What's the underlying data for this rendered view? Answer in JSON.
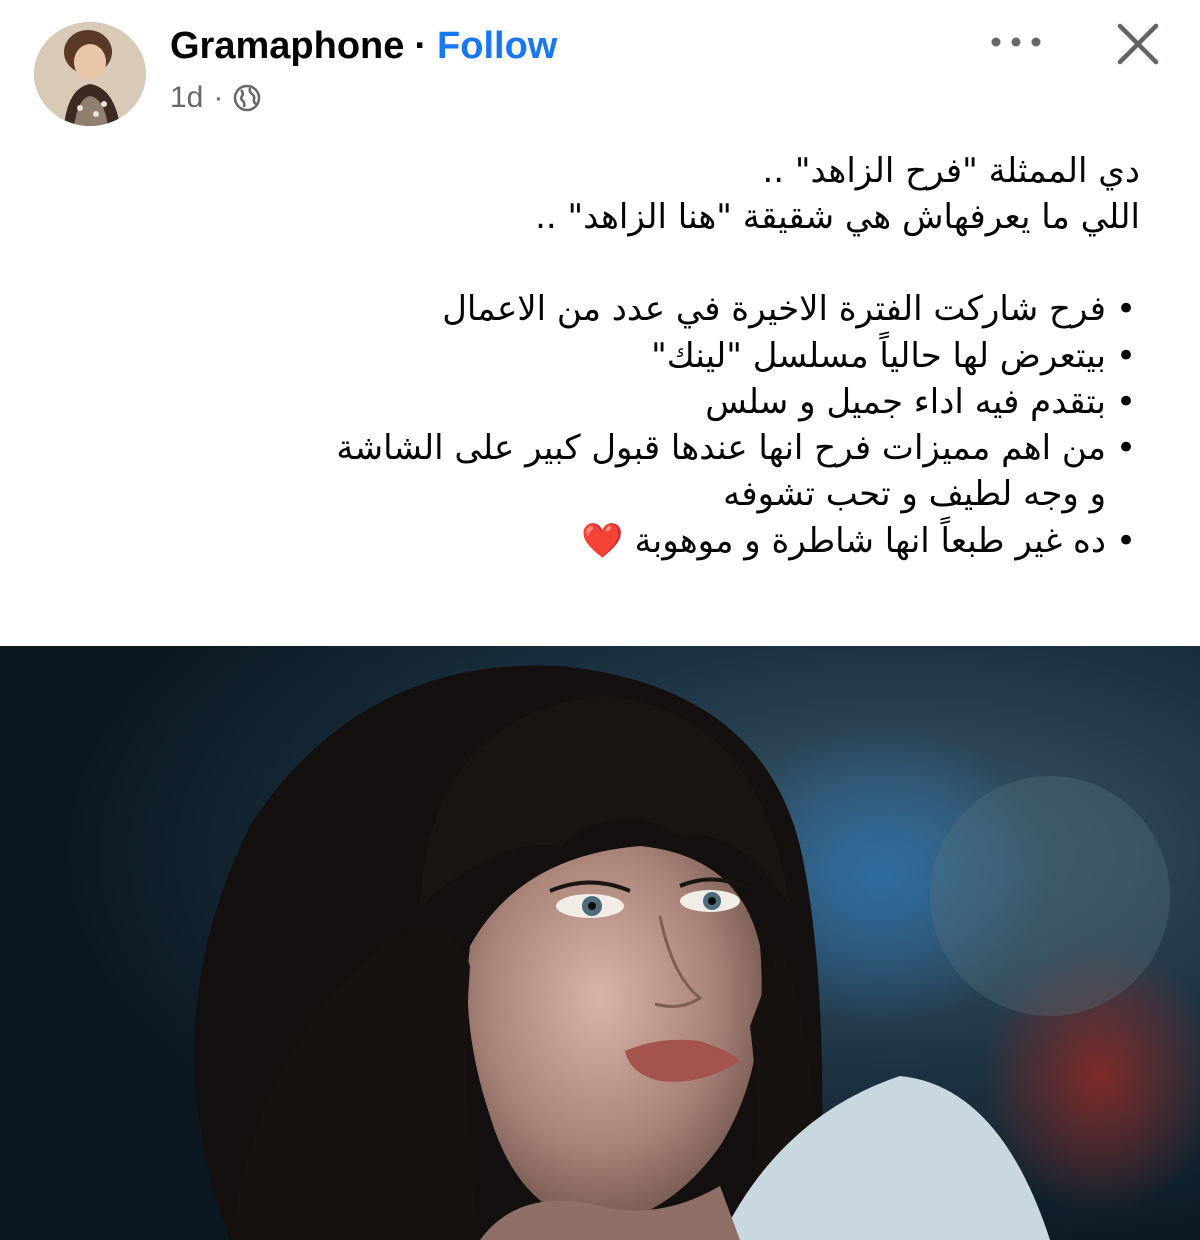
{
  "header": {
    "author_name": "Gramaphone",
    "separator": "·",
    "follow_label": "Follow",
    "timestamp": "1d",
    "meta_separator": "·",
    "privacy_icon": "globe-icon",
    "more_icon": "more-options-icon",
    "close_icon": "close-icon"
  },
  "post": {
    "intro_lines": [
      "دي الممثلة \"فرح الزاهد\"  ..",
      "اللي ما يعرفهاش هي شقيقة \"هنا الزاهد\"  .."
    ],
    "bullets": [
      "فرح شاركت الفترة الاخيرة في عدد من الاعمال",
      "بيتعرض لها حالياً مسلسل \"لينك\"",
      "بتقدم فيه اداء جميل و سلس",
      "من اهم مميزات فرح انها عندها قبول كبير على الشاشة\nو وجه لطيف و تحب تشوفه",
      "ده غير طبعاً انها شاطرة و موهوبة ❤️"
    ]
  },
  "colors": {
    "follow": "#1877f2",
    "meta_text": "#65676b",
    "text": "#050505"
  }
}
